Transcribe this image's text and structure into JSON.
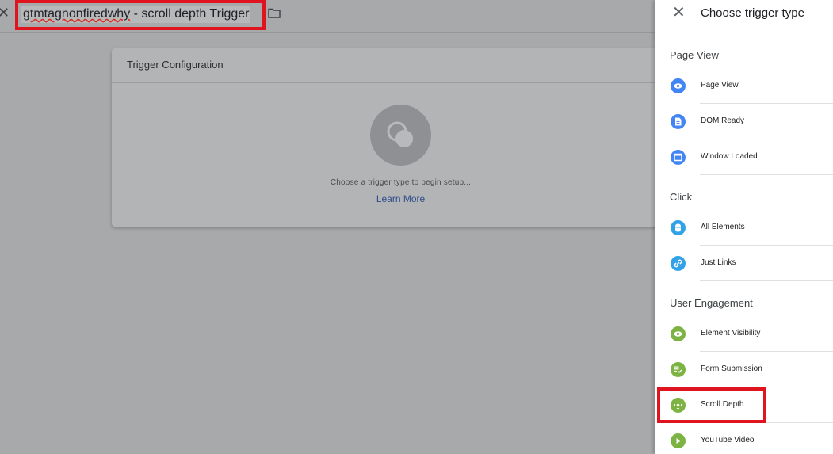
{
  "header": {
    "back_icon": "close-icon",
    "tag_name": "gtmtagnonfiredwhy",
    "title_suffix": " - scroll depth Trigger",
    "folder_icon": "folder-icon"
  },
  "card": {
    "title": "Trigger Configuration",
    "hint": "Choose a trigger type to begin setup...",
    "learn_more": "Learn More"
  },
  "panel": {
    "title": "Choose trigger type",
    "sections": [
      {
        "heading": "Page View",
        "items": [
          {
            "label": "Page View",
            "icon": "eye-icon",
            "color": "#4285f4"
          },
          {
            "label": "DOM Ready",
            "icon": "document-icon",
            "color": "#4285f4"
          },
          {
            "label": "Window Loaded",
            "icon": "window-icon",
            "color": "#4285f4"
          }
        ]
      },
      {
        "heading": "Click",
        "items": [
          {
            "label": "All Elements",
            "icon": "mouse-icon",
            "color": "#32a2e8"
          },
          {
            "label": "Just Links",
            "icon": "link-icon",
            "color": "#32a2e8"
          }
        ]
      },
      {
        "heading": "User Engagement",
        "items": [
          {
            "label": "Element Visibility",
            "icon": "eye-icon",
            "color": "#7cb342"
          },
          {
            "label": "Form Submission",
            "icon": "form-icon",
            "color": "#7cb342"
          },
          {
            "label": "Scroll Depth",
            "icon": "scroll-icon",
            "color": "#7cb342"
          },
          {
            "label": "YouTube Video",
            "icon": "play-icon",
            "color": "#7cb342"
          }
        ]
      }
    ]
  },
  "colors": {
    "highlight": "#e0141e",
    "overlay": "#a8a9ab"
  }
}
